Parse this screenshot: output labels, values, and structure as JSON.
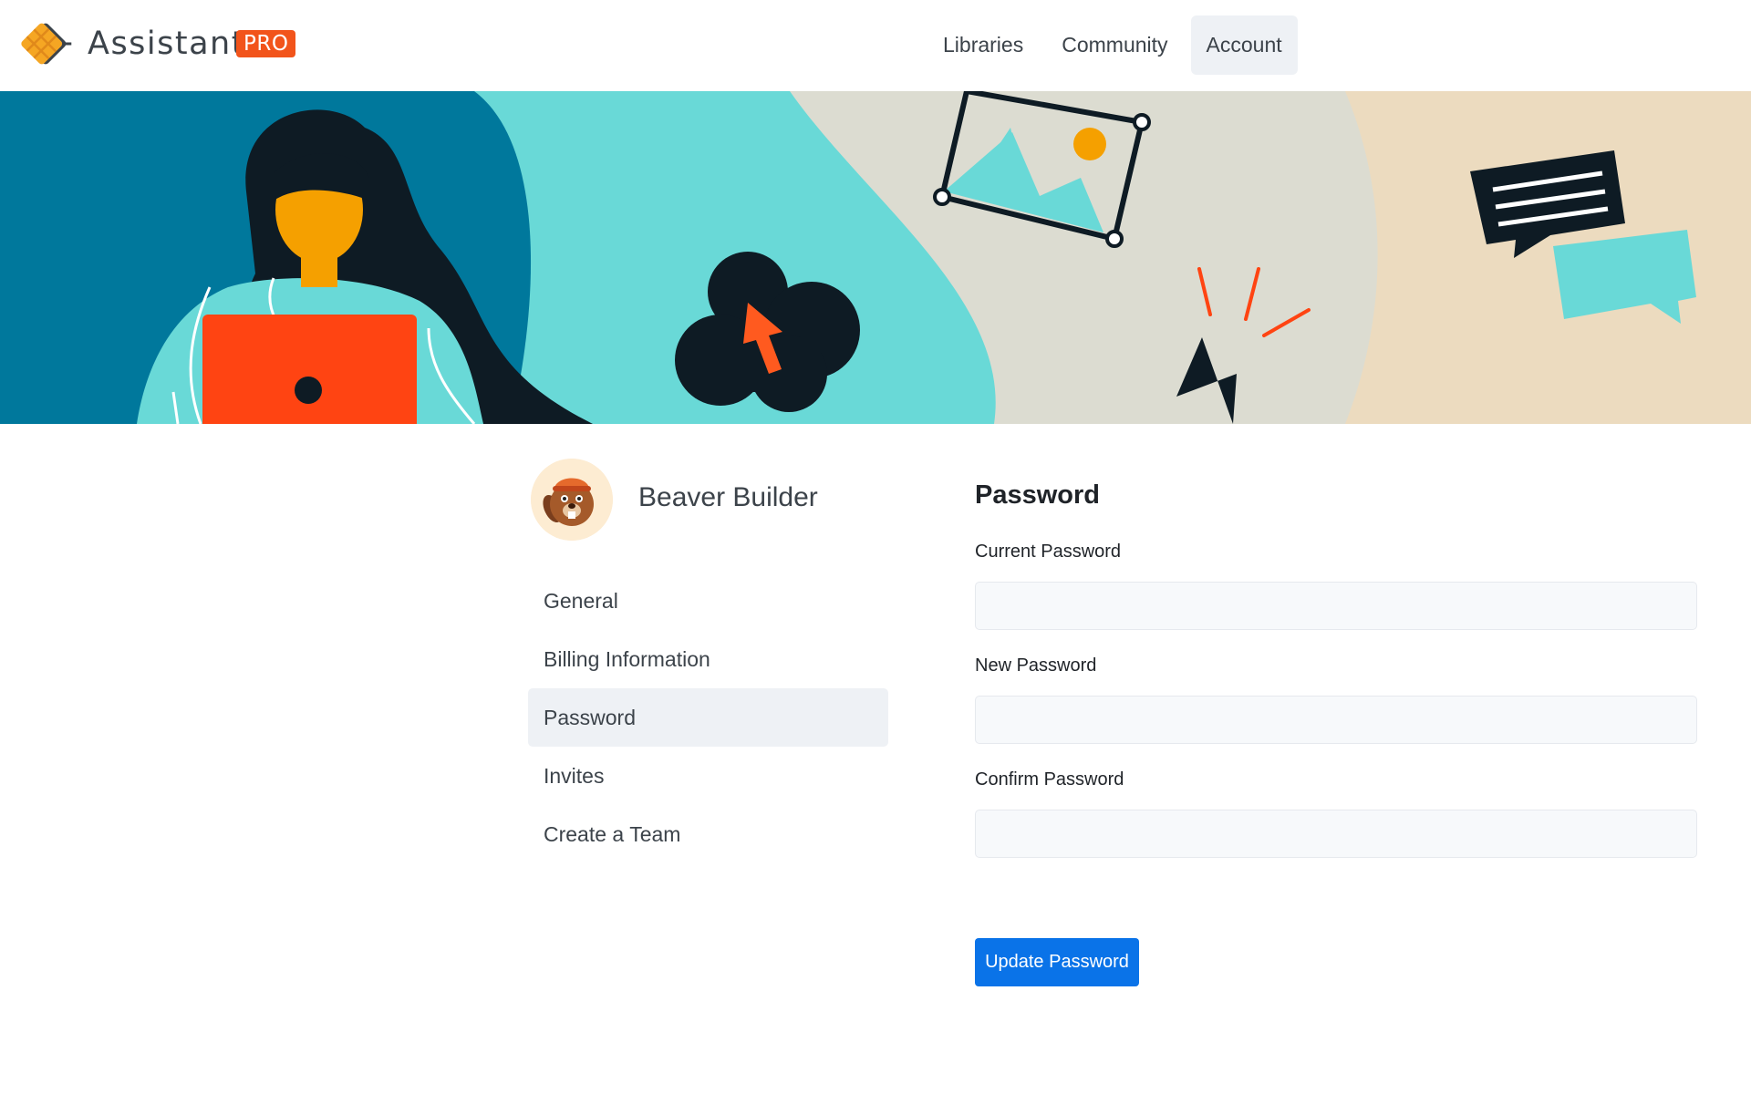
{
  "brand": {
    "name": "Assistant",
    "badge": "PRO",
    "badge_color": "#f2541b"
  },
  "nav": {
    "items": [
      {
        "label": "Libraries",
        "active": false
      },
      {
        "label": "Community",
        "active": false
      },
      {
        "label": "Account",
        "active": true
      }
    ]
  },
  "hero": {
    "icons": [
      "woman-with-laptop-illustration",
      "cloud-upload-icon",
      "image-icon",
      "cursor-icon",
      "chat-bubbles-icon"
    ]
  },
  "profile": {
    "name": "Beaver Builder",
    "avatar_icon": "beaver-avatar"
  },
  "sidebar": {
    "items": [
      {
        "label": "General",
        "active": false
      },
      {
        "label": "Billing Information",
        "active": false
      },
      {
        "label": "Password",
        "active": true
      },
      {
        "label": "Invites",
        "active": false
      },
      {
        "label": "Create a Team",
        "active": false
      }
    ]
  },
  "form": {
    "title": "Password",
    "fields": [
      {
        "label": "Current Password",
        "value": ""
      },
      {
        "label": "New Password",
        "value": ""
      },
      {
        "label": "Confirm Password",
        "value": ""
      }
    ],
    "submit_label": "Update Password"
  },
  "colors": {
    "accent": "#0a73e8",
    "active_bg": "#eef1f5",
    "brand_orange": "#f2541b"
  }
}
